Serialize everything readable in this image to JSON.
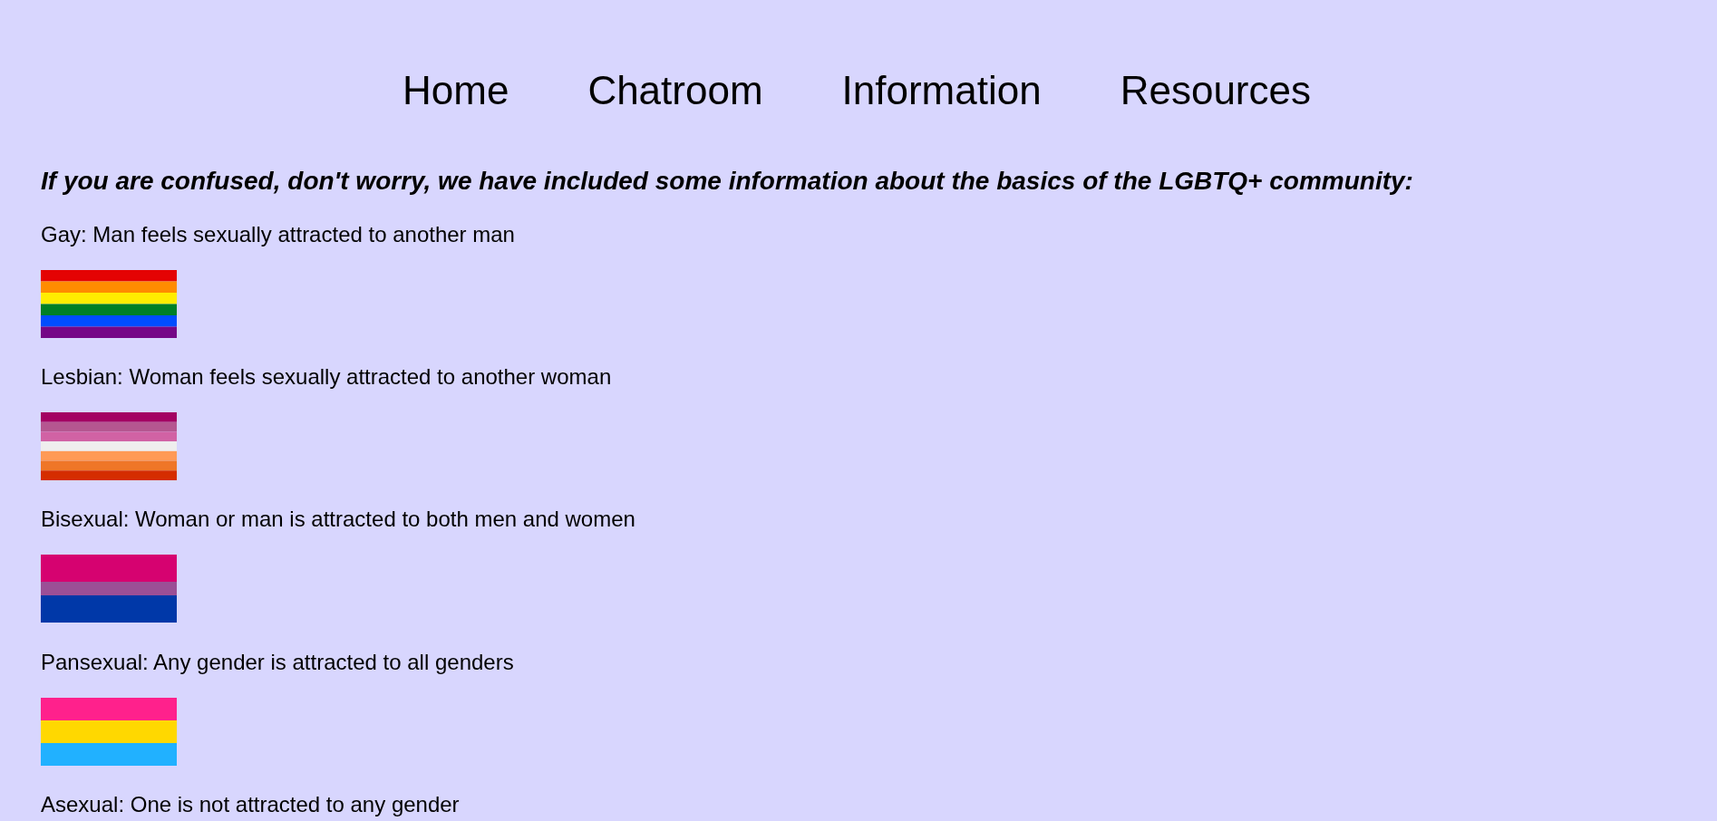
{
  "nav": [
    {
      "label": "Home"
    },
    {
      "label": "Chatroom"
    },
    {
      "label": "Information"
    },
    {
      "label": "Resources"
    }
  ],
  "intro": "If you are confused, don't worry, we have included some information about the basics of the LGBTQ+ community:",
  "items": [
    {
      "text": "Gay: Man feels sexually attracted to another man",
      "flag": {
        "stripes": [
          {
            "color": "#e40303"
          },
          {
            "color": "#ff8c00"
          },
          {
            "color": "#ffed00"
          },
          {
            "color": "#008026"
          },
          {
            "color": "#004dff"
          },
          {
            "color": "#750787"
          }
        ]
      }
    },
    {
      "text": "Lesbian: Woman feels sexually attracted to another woman",
      "flag": {
        "stripes": [
          {
            "color": "#a30262"
          },
          {
            "color": "#b55690"
          },
          {
            "color": "#d162a4"
          },
          {
            "color": "#efeeee"
          },
          {
            "color": "#ff9a56"
          },
          {
            "color": "#ef7627"
          },
          {
            "color": "#d52d00"
          }
        ]
      }
    },
    {
      "text": "Bisexual: Woman or man is attracted to both men and women",
      "flag": {
        "stripes": [
          {
            "color": "#d60270"
          },
          {
            "color": "#d60270"
          },
          {
            "color": "#9b4f96"
          },
          {
            "color": "#0038a8"
          },
          {
            "color": "#0038a8"
          }
        ]
      }
    },
    {
      "text": "Pansexual: Any gender is attracted to all genders",
      "flag": {
        "stripes": [
          {
            "color": "#ff218c"
          },
          {
            "color": "#ffd800"
          },
          {
            "color": "#21b1ff"
          }
        ]
      }
    },
    {
      "text": "Asexual: One is not attracted to any gender"
    }
  ]
}
